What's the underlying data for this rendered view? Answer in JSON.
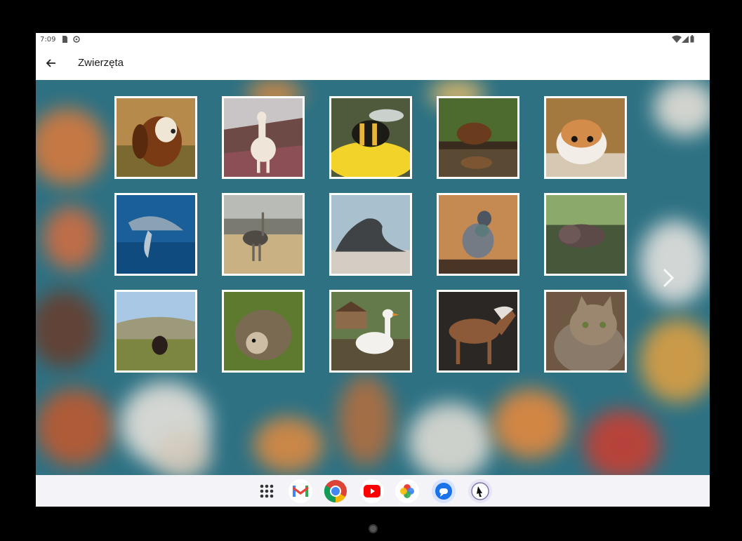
{
  "status_bar": {
    "time": "7:09"
  },
  "app_bar": {
    "title": "Zwierzęta"
  },
  "grid": {
    "rows": [
      [
        "dog",
        "llama",
        "bee",
        "beaver",
        "hamster"
      ],
      [
        "dolphin",
        "ostrich",
        "seal",
        "pigeon",
        "hippo"
      ],
      [
        "turkey",
        "hedgehog",
        "goose",
        "horse",
        "cat"
      ]
    ]
  },
  "taskbar": {
    "apps": [
      "app-drawer",
      "gmail",
      "chrome",
      "youtube",
      "photos",
      "messages",
      "pointer-app"
    ]
  },
  "colors": {
    "background_teal": "#2d7183",
    "app_bar": "#ffffff",
    "taskbar": "#f4f4f8"
  }
}
